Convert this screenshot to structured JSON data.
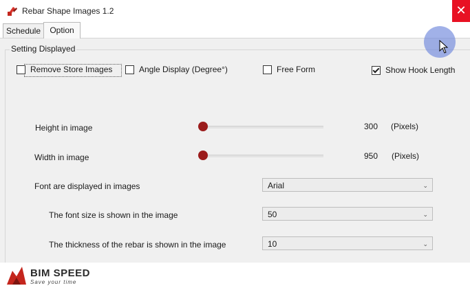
{
  "window": {
    "title": "Rebar Shape Images 1.2",
    "close_glyph": "✕"
  },
  "tabs": [
    {
      "label": "Schedule"
    },
    {
      "label": "Option"
    }
  ],
  "settings": {
    "group_label": "Setting Displayed",
    "checkboxes": [
      {
        "label": "Remove Store Images",
        "checked": false
      },
      {
        "label": "Angle Display (Degree°)",
        "checked": false
      },
      {
        "label": "Free Form",
        "checked": false
      },
      {
        "label": "Show Hook Length",
        "checked": true
      }
    ],
    "height": {
      "label": "Height in image",
      "value": "300",
      "unit": "(Pixels)",
      "slider_fraction": 0.0
    },
    "width": {
      "label": "Width in image",
      "value": "950",
      "unit": "(Pixels)",
      "slider_fraction": 0.0
    },
    "font": {
      "label": "Font are displayed in images",
      "selected": "Arial"
    },
    "font_size": {
      "label": "The font size is shown in the image",
      "selected": "50"
    },
    "thickness": {
      "label": "The thickness of the rebar is shown in the image",
      "selected": "10"
    }
  },
  "footer": {
    "brand": "BIM SPEED",
    "tagline": "Save your time"
  },
  "colors": {
    "close": "#e81123",
    "slider_thumb": "#9b1c1c",
    "logo_red": "#c4261d"
  },
  "icons": {
    "app": "rebar-app-icon",
    "cursor": "mouse-pointer-icon"
  }
}
